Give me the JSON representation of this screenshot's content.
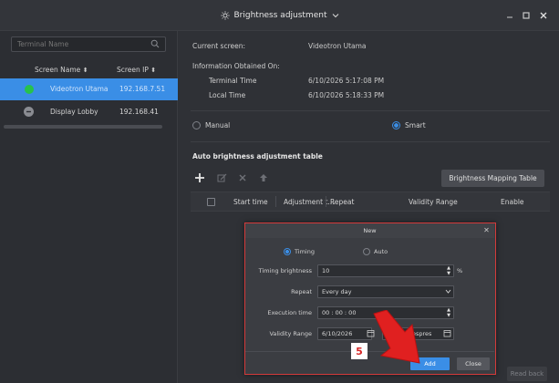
{
  "window": {
    "title": "Brightness adjustment",
    "minimize_icon": "minimize-icon",
    "maximize_icon": "maximize-icon",
    "close_icon": "close-icon"
  },
  "sidebar": {
    "search_placeholder": "Terminal Name",
    "col_name": "Screen Name",
    "col_ip": "Screen IP",
    "items": [
      {
        "name": "Videotron Utama",
        "ip": "192.168.7.51",
        "status_color": "#27c24c",
        "selected": true
      },
      {
        "name": "Display Lobby",
        "ip": "192.168.41",
        "status_color": "#8a8c92",
        "selected": false
      }
    ]
  },
  "info": {
    "current_screen_label": "Current screen:",
    "current_screen_value": "Videotron Utama",
    "obtained_label": "Information Obtained On:",
    "terminal_time_label": "Terminal Time",
    "terminal_time_value": "6/10/2026 5:17:08 PM",
    "local_time_label": "Local Time",
    "local_time_value": "6/10/2026 5:18:33 PM"
  },
  "mode": {
    "manual": "Manual",
    "smart": "Smart",
    "selected": "Smart"
  },
  "table": {
    "title": "Auto brightness adjustment table",
    "mapping_button": "Brightness Mapping Table",
    "columns": [
      "Start time",
      "Adjustment t...",
      "Repeat",
      "Validity Range",
      "Enable"
    ]
  },
  "dialog": {
    "title": "New",
    "type_timing": "Timing",
    "type_auto": "Auto",
    "type_selected": "Timing",
    "brightness_label": "Timing brightness",
    "brightness_value": "10",
    "brightness_unit": "%",
    "repeat_label": "Repeat",
    "repeat_value": "Every day",
    "execution_label": "Execution time",
    "execution_value": "00 : 00 : 00",
    "validity_label": "Validity Range",
    "validity_start": "6/10/2026",
    "validity_end_partial": "espres",
    "add_button": "Add",
    "close_button": "Close"
  },
  "footer": {
    "readback_button": "Read back"
  },
  "annotation": {
    "step_number": "5",
    "arrow_color": "#e02020",
    "highlight_color": "#d43a3a"
  },
  "colors": {
    "accent": "#3a8ee6",
    "selected_row": "#3a8ee6",
    "online": "#27c24c"
  }
}
